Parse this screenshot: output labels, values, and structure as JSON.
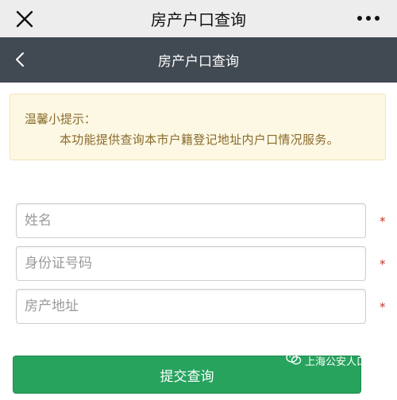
{
  "wechat_bar": {
    "title": "房产户口查询",
    "close_icon": "close-icon",
    "more_icon": "more-icon"
  },
  "nav": {
    "title": "房产户口查询",
    "back_icon": "chevron-left-icon"
  },
  "tip": {
    "title": "温馨小提示：",
    "body": "本功能提供查询本市户籍登记地址内户口情况服务。"
  },
  "form": {
    "name_placeholder": "姓名",
    "id_placeholder": "身份证号码",
    "address_placeholder": "房产地址",
    "required_mark": "*"
  },
  "submit_label": "提交查询",
  "watermark": {
    "text": "上海公安人口管理",
    "icon": "wechat-icon"
  },
  "colors": {
    "wechat_bar": "#ededed",
    "nav_bar": "#414952",
    "tip_background": "#fcf8e4",
    "tip_text": "#8a6b2c",
    "required": "#c0392b",
    "submit": "#27a35e"
  }
}
